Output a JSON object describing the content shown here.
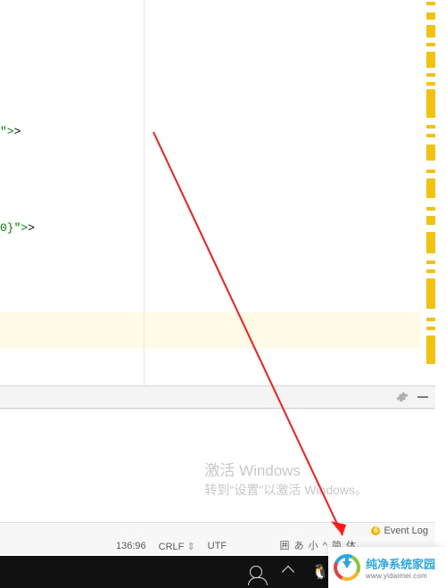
{
  "code": {
    "line1": "\">",
    "line2": "0}\">"
  },
  "watermark": {
    "title": "激活 Windows",
    "subtitle_a": "转到\"设置\"以激活",
    "subtitle_b": "Windows。"
  },
  "status": {
    "event_count": "6",
    "event_label": "Event Log",
    "position": "136:96",
    "eol": "CRLF",
    "eol_arrows": "⇕",
    "encoding": "UTF",
    "ime": "囲 あ 小 ^  简 体"
  },
  "site": {
    "name_cn": "纯净系统家园",
    "name_en": "www.yidaimei.com"
  },
  "icons": {
    "gear": "gear-icon",
    "minimize": "minimize-icon",
    "tray_chevron": "chevron-up-icon",
    "contacts": "contacts-icon",
    "qq": "penguin-icon",
    "monitor": "monitor-icon"
  }
}
